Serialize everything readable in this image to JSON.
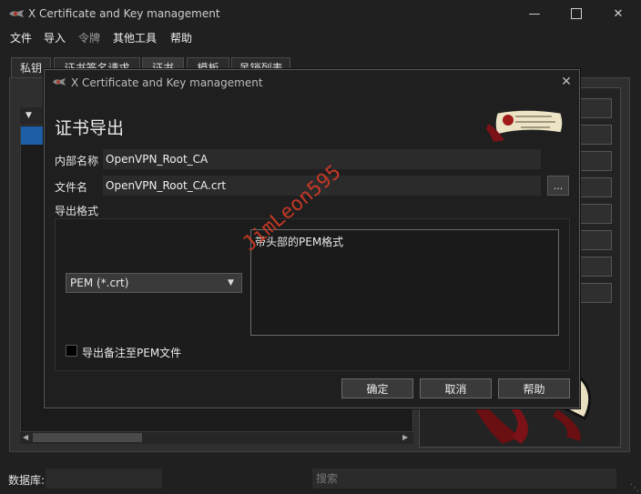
{
  "window": {
    "title": "X Certificate and Key management",
    "controls": [
      "minimize-icon",
      "maximize-icon",
      "close-icon"
    ]
  },
  "menu": [
    "文件",
    "导入",
    "令牌",
    "其他工具",
    "帮助"
  ],
  "tabs": [
    {
      "label": "私钥"
    },
    {
      "label": "证书签名请求"
    },
    {
      "label": "证书",
      "active": true
    },
    {
      "label": "模板"
    },
    {
      "label": "吊销列表"
    }
  ],
  "statusbar": {
    "db_label": "数据库:",
    "search_placeholder": "搜索"
  },
  "dialog": {
    "title": "X Certificate and Key management",
    "heading": "证书导出",
    "internal_name_label": "内部名称",
    "internal_name_value": "OpenVPN_Root_CA",
    "filename_label": "文件名",
    "filename_value": "OpenVPN_Root_CA.crt",
    "browse_label": "...",
    "export_format_label": "导出格式",
    "format_selected": "PEM (*.crt)",
    "format_description": "带头部的PEM格式",
    "checkbox_label": "导出备注至PEM文件",
    "checkbox_checked": false,
    "buttons": {
      "ok": "确定",
      "cancel": "取消",
      "help": "帮助"
    }
  },
  "watermark": "JimLeon595",
  "colors": {
    "background": "#202020",
    "selection": "#1d5fa7",
    "watermark": "#d63a26"
  }
}
